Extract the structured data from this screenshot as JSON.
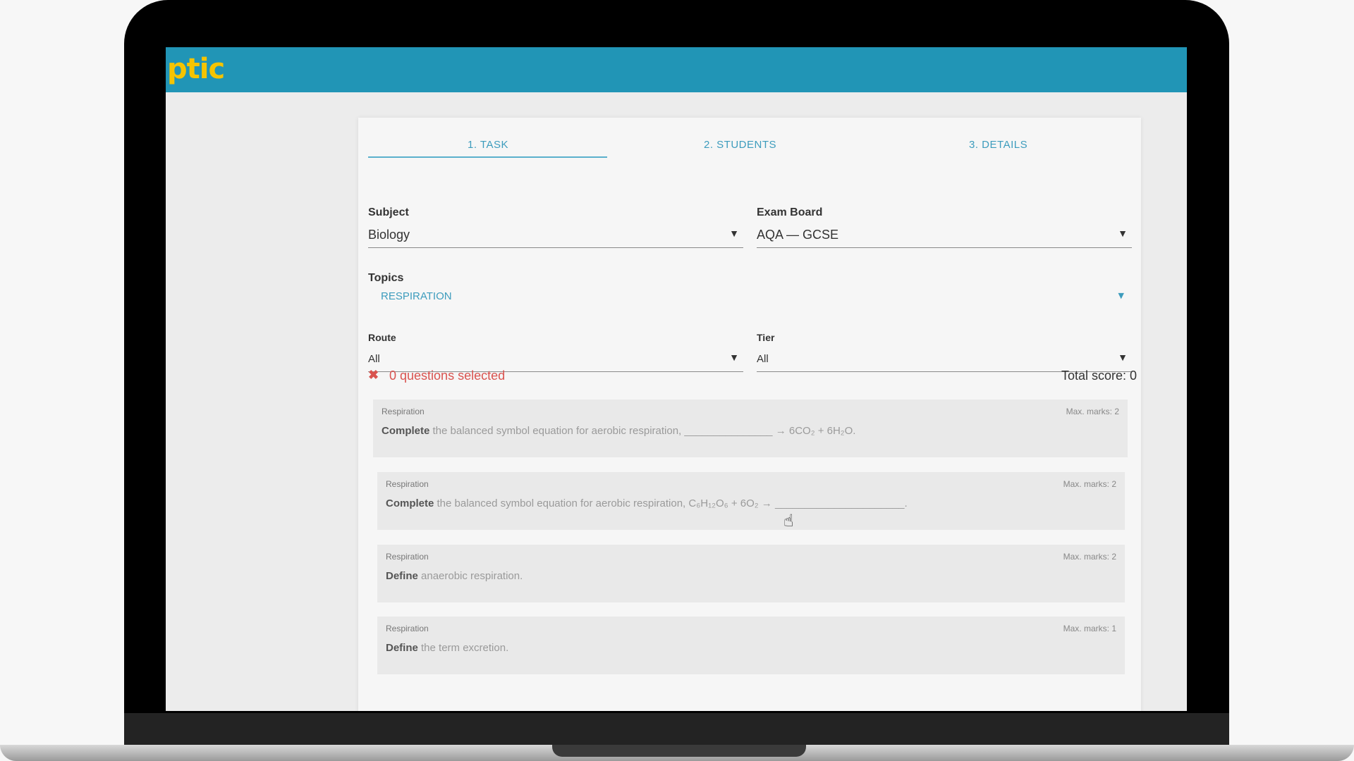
{
  "app": {
    "logo_text": "ptic",
    "brand_color": "#2195b6",
    "logo_color": "#f5c400"
  },
  "tabs": [
    {
      "label": "1. TASK",
      "active": true
    },
    {
      "label": "2. STUDENTS",
      "active": false
    },
    {
      "label": "3. DETAILS",
      "active": false
    }
  ],
  "form": {
    "subject": {
      "label": "Subject",
      "value": "Biology"
    },
    "exam_board": {
      "label": "Exam Board",
      "value": "AQA — GCSE"
    },
    "topics": {
      "label": "Topics",
      "selected": "RESPIRATION"
    },
    "route": {
      "label": "Route",
      "value": "All"
    },
    "tier": {
      "label": "Tier",
      "value": "All"
    }
  },
  "status": {
    "selected_text": "0 questions selected",
    "total_score": "Total score: 0"
  },
  "questions": [
    {
      "topic": "Respiration",
      "marks": "Max. marks: 2",
      "verb": "Complete",
      "rest": " the balanced symbol equation for aerobic respiration, _______________ → 6CO₂ + 6H₂O."
    },
    {
      "topic": "Respiration",
      "marks": "Max. marks: 2",
      "verb": "Complete",
      "rest": " the balanced symbol equation for aerobic respiration, C₆H₁₂O₆ + 6O₂ → ______________________."
    },
    {
      "topic": "Respiration",
      "marks": "Max. marks: 2",
      "verb": "Define",
      "rest": " anaerobic respiration."
    },
    {
      "topic": "Respiration",
      "marks": "Max. marks: 1",
      "verb": "Define",
      "rest": " the term excretion."
    }
  ],
  "icons": {
    "dropdown": "triangle-down-icon",
    "status": "cross-icon",
    "cursor": "hand-pointer-icon"
  }
}
